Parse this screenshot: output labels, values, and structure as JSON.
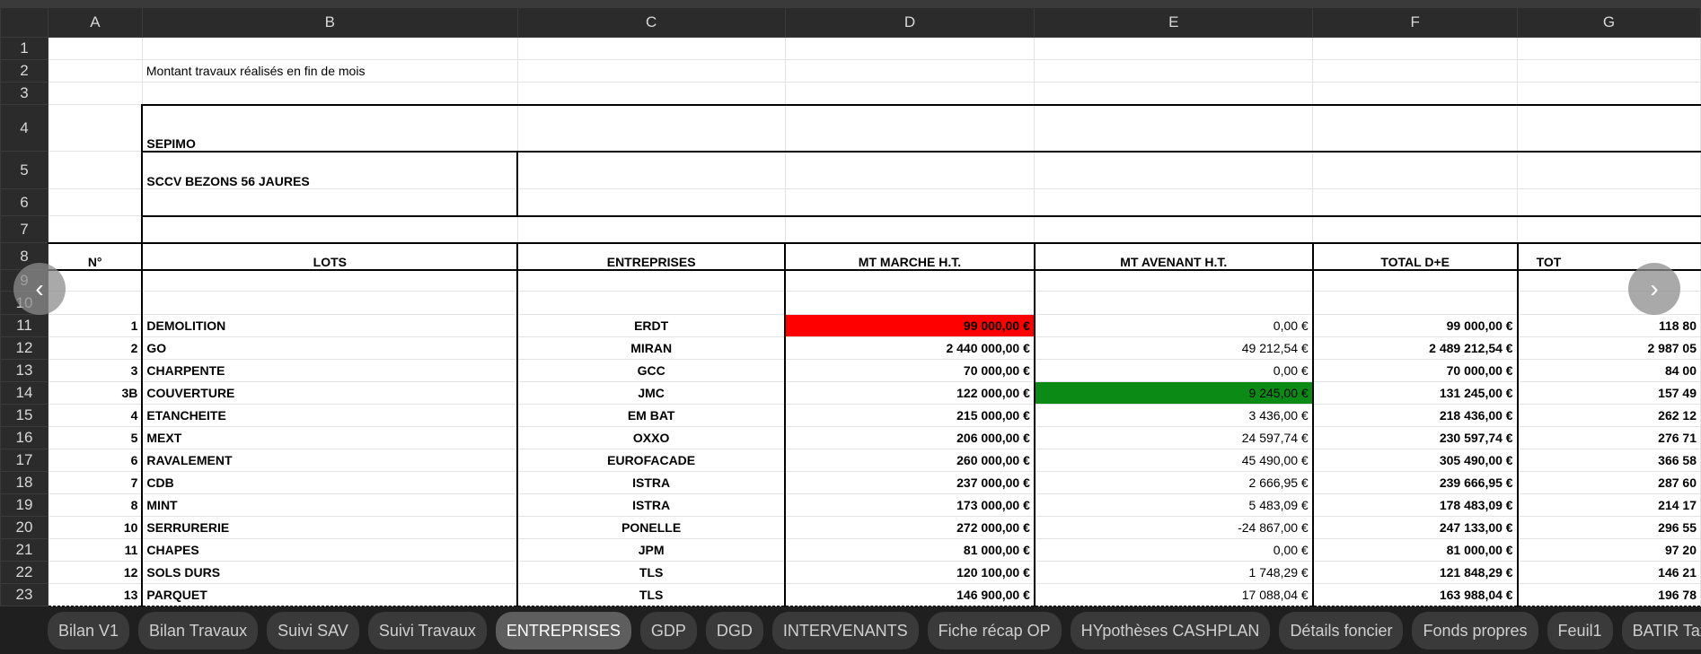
{
  "columns": [
    "A",
    "B",
    "C",
    "D",
    "E",
    "F",
    "G"
  ],
  "rows": [
    "1",
    "2",
    "3",
    "4",
    "5",
    "6",
    "7",
    "8",
    "9",
    "10",
    "11",
    "12",
    "13",
    "14",
    "15",
    "16",
    "17",
    "18",
    "19",
    "20",
    "21",
    "22",
    "23"
  ],
  "sheet": {
    "subtitle": "Montant travaux réalisés en fin de mois",
    "company": "SEPIMO",
    "project": "SCCV BEZONS 56 JAURES",
    "headers": {
      "num": "N°",
      "lots": "LOTS",
      "entreprises": "ENTREPRISES",
      "mt_marche": "MT MARCHE H.T.",
      "mt_avenant": "MT AVENANT H.T.",
      "total_de": "TOTAL D+E",
      "tot": "TOT"
    },
    "data_rows": [
      {
        "num": "1",
        "lot": "DEMOLITION",
        "entreprise": "ERDT",
        "marche": "99 000,00 €",
        "avenant": "0,00 €",
        "total": "99 000,00 €",
        "g": "118 80"
      },
      {
        "num": "2",
        "lot": "GO",
        "entreprise": "MIRAN",
        "marche": "2 440 000,00 €",
        "avenant": "49 212,54 €",
        "total": "2 489 212,54 €",
        "g": "2 987 05"
      },
      {
        "num": "3",
        "lot": "CHARPENTE",
        "entreprise": "GCC",
        "marche": "70 000,00 €",
        "avenant": "0,00 €",
        "total": "70 000,00 €",
        "g": "84 00"
      },
      {
        "num": "3B",
        "lot": "COUVERTURE",
        "entreprise": "JMC",
        "marche": "122 000,00 €",
        "avenant": "9 245,00 €",
        "total": "131 245,00 €",
        "g": "157 49"
      },
      {
        "num": "4",
        "lot": "ETANCHEITE",
        "entreprise": "EM BAT",
        "marche": "215 000,00 €",
        "avenant": "3 436,00 €",
        "total": "218 436,00 €",
        "g": "262 12"
      },
      {
        "num": "5",
        "lot": "MEXT",
        "entreprise": "OXXO",
        "marche": "206 000,00 €",
        "avenant": "24 597,74 €",
        "total": "230 597,74 €",
        "g": "276 71"
      },
      {
        "num": "6",
        "lot": "RAVALEMENT",
        "entreprise": "EUROFACADE",
        "marche": "260 000,00 €",
        "avenant": "45 490,00 €",
        "total": "305 490,00 €",
        "g": "366 58"
      },
      {
        "num": "7",
        "lot": "CDB",
        "entreprise": "ISTRA",
        "marche": "237 000,00 €",
        "avenant": "2 666,95 €",
        "total": "239 666,95 €",
        "g": "287 60"
      },
      {
        "num": "8",
        "lot": "MINT",
        "entreprise": "ISTRA",
        "marche": "173 000,00 €",
        "avenant": "5 483,09 €",
        "total": "178 483,09 €",
        "g": "214 17"
      },
      {
        "num": "10",
        "lot": "SERRURERIE",
        "entreprise": "PONELLE",
        "marche": "272 000,00 €",
        "avenant": "-24 867,00 €",
        "total": "247 133,00 €",
        "g": "296 55"
      },
      {
        "num": "11",
        "lot": "CHAPES",
        "entreprise": "JPM",
        "marche": "81 000,00 €",
        "avenant": "0,00 €",
        "total": "81 000,00 €",
        "g": "97 20"
      },
      {
        "num": "12",
        "lot": "SOLS DURS",
        "entreprise": "TLS",
        "marche": "120 100,00 €",
        "avenant": "1 748,29 €",
        "total": "121 848,29 €",
        "g": "146 21"
      },
      {
        "num": "13",
        "lot": "PARQUET",
        "entreprise": "TLS",
        "marche": "146 900,00 €",
        "avenant": "17 088,04 €",
        "total": "163 988,04 €",
        "g": "196 78"
      }
    ]
  },
  "nav": {
    "prev_icon": "chevron-left-icon",
    "next_icon": "chevron-right-icon",
    "prev_glyph": "‹",
    "next_glyph": "›"
  },
  "tabs": [
    {
      "label": "Bilan V1"
    },
    {
      "label": "Bilan Travaux"
    },
    {
      "label": "Suivi SAV"
    },
    {
      "label": "Suivi Travaux"
    },
    {
      "label": "ENTREPRISES",
      "active": true
    },
    {
      "label": "GDP"
    },
    {
      "label": "DGD"
    },
    {
      "label": "INTERVENANTS"
    },
    {
      "label": "Fiche récap OP"
    },
    {
      "label": "HYpothèses CASHPLAN"
    },
    {
      "label": "Détails foncier"
    },
    {
      "label": "Fonds propres"
    },
    {
      "label": "Feuil1"
    },
    {
      "label": "BATIR Taxes"
    }
  ],
  "colors": {
    "red_fill": "#ff0000",
    "green_fill": "#0b8a16",
    "title_red": "#e31b1b"
  }
}
